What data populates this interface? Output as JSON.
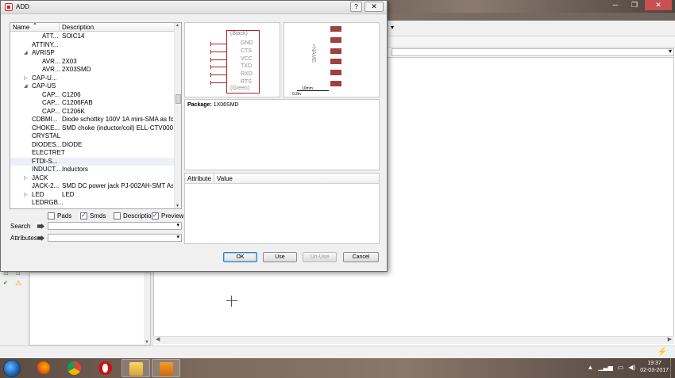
{
  "background": {
    "toolbar_dropdown_arrow": "▾",
    "status_icon": "⚡"
  },
  "dialog": {
    "title": "ADD",
    "help_label": "?",
    "close_label": "✕",
    "tree": {
      "col_name": "Name",
      "col_description": "Description",
      "rows": [
        {
          "name": "ATT...",
          "desc": "SOIC14",
          "indent": 2,
          "exp": ""
        },
        {
          "name": "ATTINY...",
          "desc": "",
          "indent": 1,
          "exp": ""
        },
        {
          "name": "AVRISP",
          "desc": "",
          "indent": 1,
          "exp": "◢"
        },
        {
          "name": "AVR...",
          "desc": "2X03",
          "indent": 2,
          "exp": ""
        },
        {
          "name": "AVR...",
          "desc": "2X03SMD",
          "indent": 2,
          "exp": ""
        },
        {
          "name": "CAP-U...",
          "desc": "",
          "indent": 1,
          "exp": "▷"
        },
        {
          "name": "CAP-US",
          "desc": "",
          "indent": 1,
          "exp": "◢"
        },
        {
          "name": "CAP...",
          "desc": "C1206",
          "indent": 2,
          "exp": ""
        },
        {
          "name": "CAP...",
          "desc": "C1206FAB",
          "indent": 2,
          "exp": ""
        },
        {
          "name": "CAP...",
          "desc": "C1206K",
          "indent": 2,
          "exp": ""
        },
        {
          "name": "CDBMI...",
          "desc": "Diode schottky 100V 1A mini-SMA as fo...",
          "indent": 1,
          "exp": ""
        },
        {
          "name": "CHOKE...",
          "desc": "SMD choke (inductor/coil) ELL-CTV000...",
          "indent": 1,
          "exp": ""
        },
        {
          "name": "CRYSTAL",
          "desc": "",
          "indent": 1,
          "exp": ""
        },
        {
          "name": "DIODES...",
          "desc": "DIODE",
          "indent": 1,
          "exp": ""
        },
        {
          "name": "ELECTRET",
          "desc": "",
          "indent": 1,
          "exp": ""
        },
        {
          "name": "FTDI-S...",
          "desc": "",
          "indent": 1,
          "exp": "",
          "selected": true
        },
        {
          "name": "INDUCT...",
          "desc": "Inductors",
          "indent": 1,
          "exp": ""
        },
        {
          "name": "JACK",
          "desc": "",
          "indent": 1,
          "exp": "▷"
        },
        {
          "name": "JACK-2...",
          "desc": "SMD DC power jack PJ-002AH-SMT As f...",
          "indent": 1,
          "exp": ""
        },
        {
          "name": "LED",
          "desc": "LED",
          "indent": 1,
          "exp": "▷"
        },
        {
          "name": "LEDRGB...",
          "desc": "",
          "indent": 1,
          "exp": ""
        }
      ]
    },
    "checkboxes": [
      {
        "label": "Pads",
        "checked": false
      },
      {
        "label": "Smds",
        "checked": true
      },
      {
        "label": "Description",
        "checked": false
      },
      {
        "label": "Preview",
        "checked": true
      }
    ],
    "search_label": "Search",
    "search_value": "",
    "attributes_label": "Attributes",
    "attributes_value": "",
    "symbol": {
      "top_label": "(Black)",
      "bottom_label": "(Green)",
      "pins": [
        "GND",
        "CTS",
        "VCC",
        "TXD",
        "RXD",
        "RTS"
      ]
    },
    "package": {
      "name": ">NAME",
      "scale_label": "10mm",
      "scale_label_2": "0.2in",
      "pad_count": 6
    },
    "description": {
      "key": "Package:",
      "value": "1X06SMD"
    },
    "attributes_table": {
      "col_attribute": "Attribute",
      "col_value": "Value"
    },
    "buttons": {
      "ok": "OK",
      "use": "Use",
      "unuse": "Un-Use",
      "cancel": "Cancel"
    }
  },
  "taskbar": {
    "time": "19:37",
    "date": "02-03-2017",
    "apps": [
      "firefox",
      "chrome",
      "opera",
      "file-explorer",
      "eagle"
    ]
  }
}
